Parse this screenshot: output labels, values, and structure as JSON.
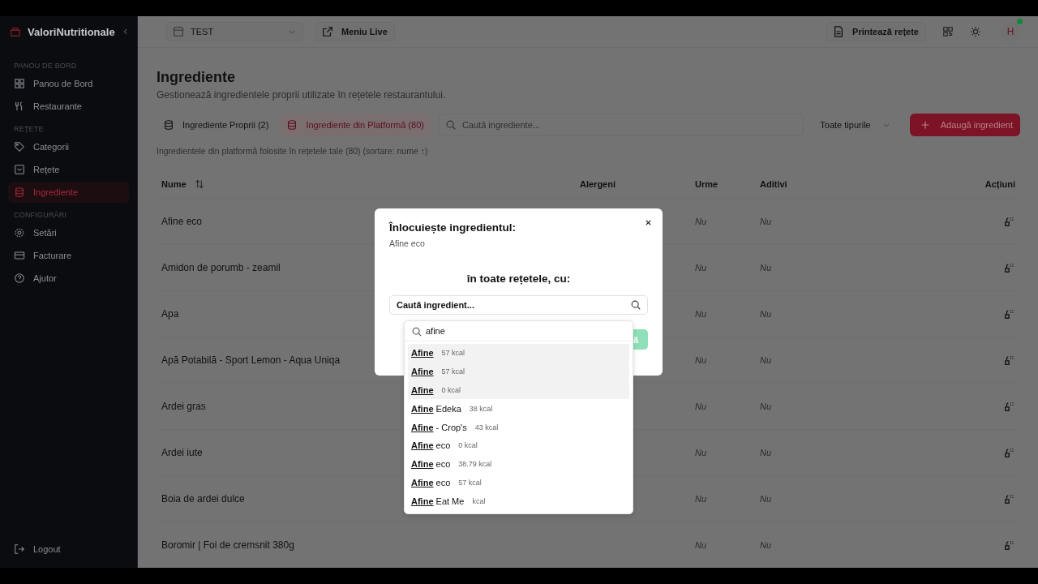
{
  "sidebar": {
    "brand": "ValoriNutritionale",
    "sections": [
      {
        "title": "PANOU DE BORD",
        "items": [
          {
            "label": "Panou de Bord",
            "selected": false
          },
          {
            "label": "Restaurante",
            "selected": false
          }
        ]
      },
      {
        "title": "REȚETE",
        "items": [
          {
            "label": "Categorii",
            "selected": false
          },
          {
            "label": "Rețete",
            "selected": false
          },
          {
            "label": "Ingrediente",
            "selected": true
          }
        ]
      },
      {
        "title": "CONFIGURĂRI",
        "items": [
          {
            "label": "Setări",
            "selected": false
          },
          {
            "label": "Facturare",
            "selected": false
          },
          {
            "label": "Ajutor",
            "selected": false
          }
        ]
      }
    ],
    "logout": "Logout"
  },
  "topbar": {
    "restaurant": "TEST",
    "live": "Meniu Live",
    "print": "Printează rețete",
    "avatar": "H",
    "online": true
  },
  "page": {
    "title": "Ingrediente",
    "subtitle": "Gestionează ingredientele proprii utilizate în rețetele restaurantului.",
    "tabs": [
      {
        "label": "Ingrediente Proprii (2)",
        "selected": false
      },
      {
        "label": "Ingrediente din Platformă (80)",
        "selected": true
      }
    ],
    "search": {
      "placeholder": "Caută ingrediente..."
    },
    "type_filter": "Toate tipurile",
    "add_button": "Adaugă ingredient",
    "note": "Ingredientele din platformă folosite în rețetele tale (80) (sortare: nume ↑)"
  },
  "table": {
    "columns": [
      "Nume",
      "Alergeni",
      "Urme",
      "Aditivi",
      "Acțiuni"
    ],
    "rows": [
      {
        "name": "Afine eco",
        "urme": "Nu",
        "aditivi": "Nu"
      },
      {
        "name": "Amidon de porumb - zeamil",
        "urme": "Nu",
        "aditivi": "Nu"
      },
      {
        "name": "Apa",
        "urme": "Nu",
        "aditivi": "Nu"
      },
      {
        "name": "Apă Potabilă - Sport Lemon - Aqua Uniqa",
        "urme": "Nu",
        "aditivi": "Nu"
      },
      {
        "name": "Ardei gras",
        "urme": "Nu",
        "aditivi": "Nu"
      },
      {
        "name": "Ardei iute",
        "urme": "Nu",
        "aditivi": "Nu"
      },
      {
        "name": "Boia de ardei dulce",
        "urme": "Nu",
        "aditivi": "Nu"
      },
      {
        "name": "Boromir | Foi de cremsnit 380g",
        "urme": "Nu",
        "aditivi": "Nu"
      }
    ]
  },
  "modal": {
    "title": "Înlocuiește ingredientul:",
    "ingredient": "Afine eco",
    "prompt": "în toate rețetele, cu:",
    "select": {
      "placeholder": "Caută ingredient..."
    },
    "confirm_fragment": "ă",
    "dropdown": {
      "query": "afine",
      "results": [
        {
          "match": "Afine",
          "kcal": "57 kcal",
          "highlighted": true
        },
        {
          "match": "Afine",
          "kcal": "57 kcal",
          "highlighted": true
        },
        {
          "match": "Afine",
          "kcal": "0 kcal",
          "highlighted": true
        },
        {
          "match": "Afine",
          "rest": "Edeka",
          "kcal": "38 kcal",
          "highlighted": false
        },
        {
          "match": "Afine",
          "rest": "- Crop's",
          "kcal": "43 kcal",
          "highlighted": false
        },
        {
          "match": "Afine",
          "rest": "eco",
          "kcal": "0 kcal",
          "highlighted": false
        },
        {
          "match": "Afine",
          "rest": "eco",
          "kcal": "38.79 kcal",
          "highlighted": false
        },
        {
          "match": "Afine",
          "rest": "eco",
          "kcal": "57 kcal",
          "highlighted": false
        },
        {
          "match": "Afine",
          "rest": "Eat Me",
          "kcal": "kcal",
          "highlighted": false
        }
      ]
    }
  }
}
